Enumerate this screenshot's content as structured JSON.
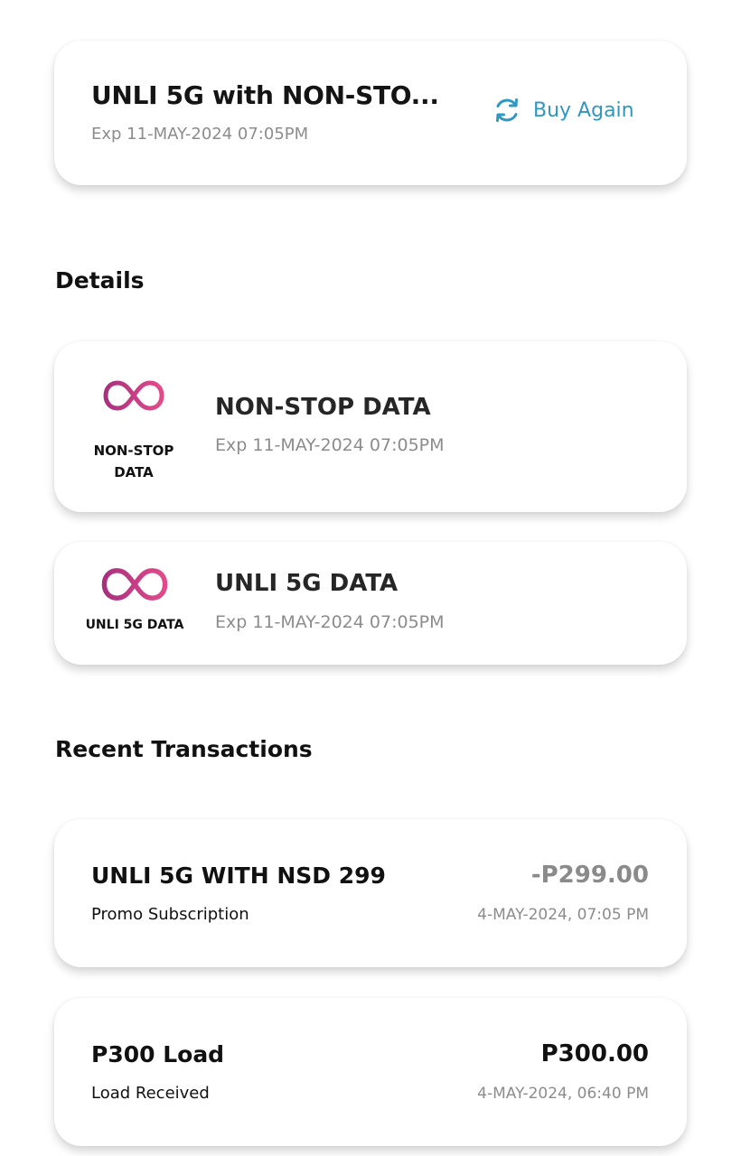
{
  "promo": {
    "name": "UNLI 5G with NON-STO...",
    "expiry": "Exp 11-MAY-2024 07:05PM",
    "buy_again_label": "Buy Again",
    "buy_again_icon": "refresh-icon",
    "accent_color": "#2f97c1"
  },
  "details": {
    "title": "Details",
    "items": [
      {
        "icon": "infinity-icon",
        "icon_caption": "NON-STOP DATA",
        "name": "NON-STOP DATA",
        "expiry": "Exp 11-MAY-2024 07:05PM"
      },
      {
        "icon": "infinity-icon",
        "icon_caption": "UNLI 5G DATA",
        "name": "UNLI 5G DATA",
        "expiry": "Exp 11-MAY-2024 07:05PM"
      }
    ],
    "icon_gradient": [
      "#a8307e",
      "#e24b8a"
    ]
  },
  "transactions": {
    "title": "Recent Transactions",
    "items": [
      {
        "title": "UNLI 5G WITH NSD 299",
        "type": "Promo Subscription",
        "amount": "-P299.00",
        "date": "4-MAY-2024, 07:05 PM"
      },
      {
        "title": "P300 Load",
        "type": "Load Received",
        "amount": "P300.00",
        "date": "4-MAY-2024, 06:40 PM"
      }
    ]
  }
}
